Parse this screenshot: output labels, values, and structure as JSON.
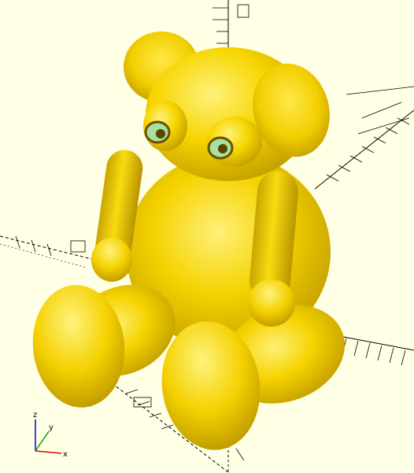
{
  "viewport": {
    "background": "#ffffe5",
    "model_color": "#f5d300",
    "model_highlight": "#fff07a",
    "model_shadow": "#b89400",
    "eye_inner_color": "#a8e0a0",
    "grid_color": "#000000"
  },
  "model": {
    "name": "teddy-bear"
  },
  "axes_gizmo": {
    "z_label": "z",
    "y_label": "y",
    "x_label": "x",
    "x_color": "#e00000",
    "y_color": "#00a000",
    "z_color": "#0000e0"
  }
}
